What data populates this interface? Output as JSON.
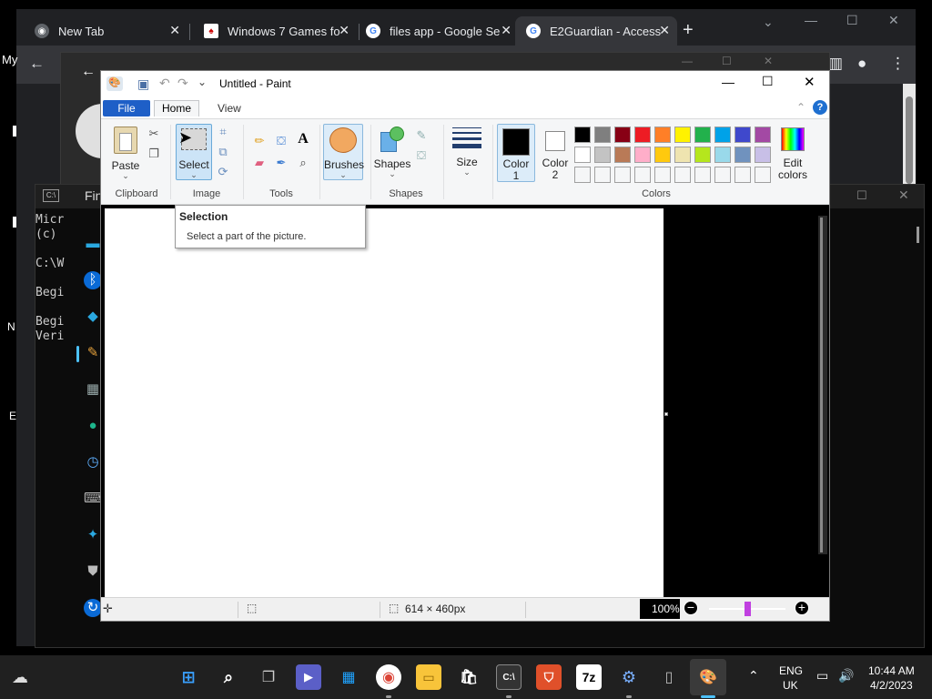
{
  "chrome": {
    "tabs": [
      {
        "title": "New Tab",
        "icon": "chrome-icon"
      },
      {
        "title": "Windows 7 Games fo",
        "icon": "cards-icon"
      },
      {
        "title": "files app - Google Se",
        "icon": "google-icon"
      },
      {
        "title": "E2Guardian - Access",
        "icon": "google-icon"
      }
    ],
    "new_tab_glyph": "+",
    "side_text_top": "My",
    "side_text_n": "N",
    "side_text_e": "E"
  },
  "cmd": {
    "tab_label": "Fin",
    "lines": [
      "Micr",
      "(c)",
      "",
      "C:\\W",
      "",
      "Begi",
      "",
      "Begi",
      "Veri"
    ]
  },
  "paint": {
    "title": "Untitled - Paint",
    "tabs": {
      "file": "File",
      "home": "Home",
      "view": "View"
    },
    "groups": {
      "clipboard": "Clipboard",
      "image": "Image",
      "tools": "Tools",
      "shapes": "Shapes",
      "colors": "Colors"
    },
    "buttons": {
      "paste": "Paste",
      "select": "Select",
      "brushes": "Brushes",
      "shapes": "Shapes",
      "size": "Size",
      "color1": "Color\n1",
      "color1_a": "Color",
      "color1_b": "1",
      "color2_a": "Color",
      "color2_b": "2",
      "edit_colors_a": "Edit",
      "edit_colors_b": "colors"
    },
    "tooltip": {
      "title": "Selection",
      "body": "Select a part of the picture."
    },
    "status": {
      "size": "614 × 460px",
      "zoom": "100%"
    },
    "palette_row1": [
      "#000000",
      "#7f7f7f",
      "#880015",
      "#ed1c24",
      "#ff7f27",
      "#fff200",
      "#22b14c",
      "#00a2e8",
      "#3f48cc",
      "#a349a4"
    ],
    "palette_row2": [
      "#ffffff",
      "#c3c3c3",
      "#b97a57",
      "#ffaec9",
      "#ffc90e",
      "#efe4b0",
      "#b5e61d",
      "#99d9ea",
      "#7092be",
      "#c8bfe7"
    ],
    "color1": "#000000",
    "color2": "#ffffff"
  },
  "taskbar": {
    "lang": "ENG",
    "region": "UK",
    "time": "10:44 AM",
    "date": "4/2/2023",
    "sevenzip_label": "7z",
    "cmd_label": "C:\\"
  }
}
